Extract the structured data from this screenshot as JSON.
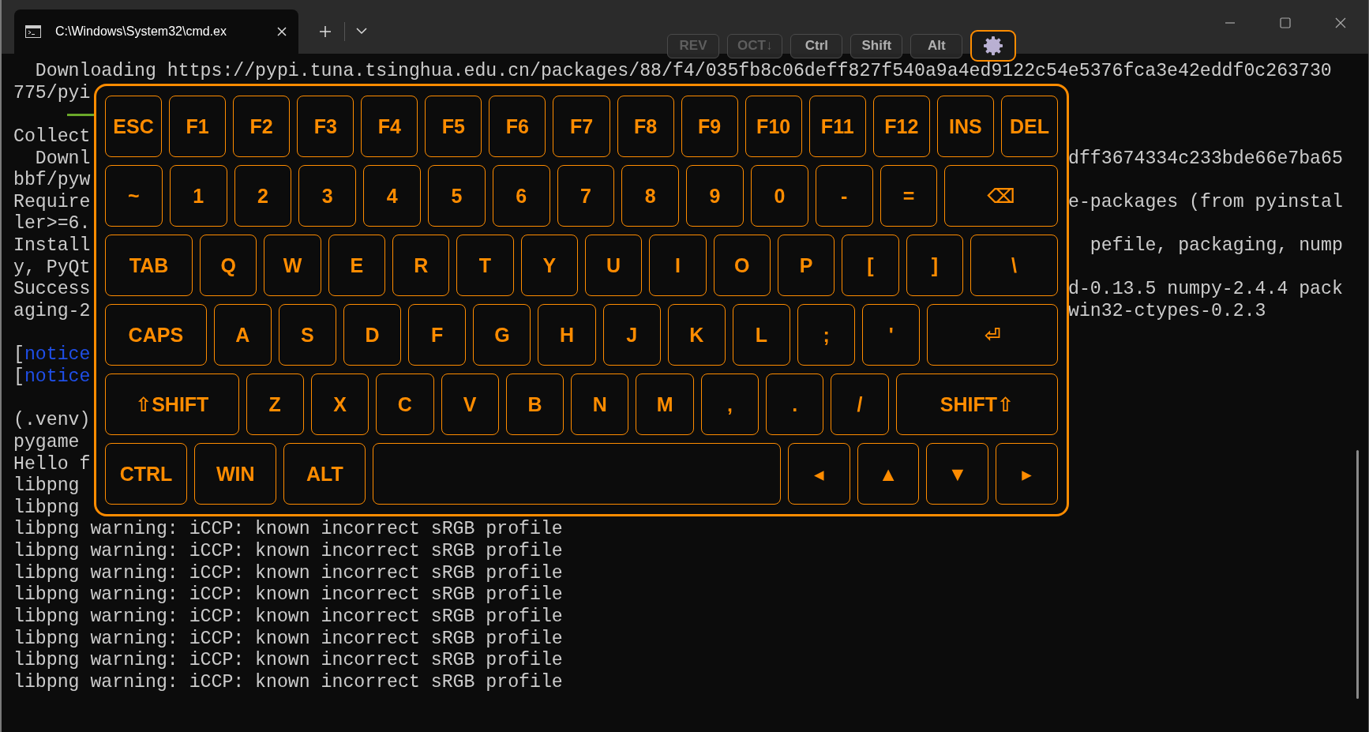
{
  "window": {
    "tab_title": "C:\\Windows\\System32\\cmd.ex"
  },
  "toolbar": {
    "items": [
      {
        "kind": "text",
        "label": "REV",
        "disabled": true,
        "active": false
      },
      {
        "kind": "text",
        "label": "OCT↓",
        "disabled": true,
        "active": false
      },
      {
        "kind": "text",
        "label": "Ctrl",
        "disabled": false,
        "active": false
      },
      {
        "kind": "text",
        "label": "Shift",
        "disabled": false,
        "active": false
      },
      {
        "kind": "text",
        "label": "Alt",
        "disabled": false,
        "active": false
      },
      {
        "kind": "settings",
        "disabled": false,
        "active": true
      }
    ]
  },
  "terminal": {
    "lines": [
      {
        "kind": "text",
        "text": "  Downloading https://pypi.tuna.tsinghua.edu.cn/packages/88/f4/035fb8c06deff827f540a9a4ed9122c54e5376fca3e42eddf0c263730"
      },
      {
        "kind": "text",
        "text": "775/pyi"
      },
      {
        "kind": "progress",
        "level": 1
      },
      {
        "kind": "text",
        "text": "Collect"
      },
      {
        "kind": "text",
        "text": "  Downl",
        "right": "dff3674334c233bde66e7ba65"
      },
      {
        "kind": "text",
        "text": "bbf/pyw"
      },
      {
        "kind": "text",
        "text": "Require",
        "right": "e-packages (from pyinstal"
      },
      {
        "kind": "text",
        "text": "ler>=6."
      },
      {
        "kind": "text",
        "text": "Install",
        "right": "  pefile, packaging, nump"
      },
      {
        "kind": "text",
        "text": "y, PyQt"
      },
      {
        "kind": "text",
        "text": "Success",
        "right": "d-0.13.5 numpy-2.4.4 pack"
      },
      {
        "kind": "text",
        "text": "aging-2",
        "right": "win32-ctypes-0.2.3"
      },
      {
        "kind": "blank"
      },
      {
        "kind": "text",
        "segments": [
          {
            "kind": "plain",
            "text": "["
          },
          {
            "kind": "notice",
            "text": "notice"
          }
        ]
      },
      {
        "kind": "text",
        "segments": [
          {
            "kind": "plain",
            "text": "["
          },
          {
            "kind": "notice",
            "text": "notice"
          }
        ]
      },
      {
        "kind": "blank"
      },
      {
        "kind": "text",
        "text": "(.venv)"
      },
      {
        "kind": "text",
        "text": "pygame"
      },
      {
        "kind": "text",
        "text": "Hello f"
      },
      {
        "kind": "text",
        "text": "libpng"
      },
      {
        "kind": "text",
        "text": "libpng"
      },
      {
        "kind": "text",
        "text": "libpng warning: iCCP: known incorrect sRGB profile"
      },
      {
        "kind": "text",
        "text": "libpng warning: iCCP: known incorrect sRGB profile"
      },
      {
        "kind": "text",
        "text": "libpng warning: iCCP: known incorrect sRGB profile"
      },
      {
        "kind": "text",
        "text": "libpng warning: iCCP: known incorrect sRGB profile"
      },
      {
        "kind": "text",
        "text": "libpng warning: iCCP: known incorrect sRGB profile"
      },
      {
        "kind": "text",
        "text": "libpng warning: iCCP: known incorrect sRGB profile"
      },
      {
        "kind": "text",
        "text": "libpng warning: iCCP: known incorrect sRGB profile"
      },
      {
        "kind": "text",
        "text": "libpng warning: iCCP: known incorrect sRGB profile"
      }
    ]
  },
  "keyboard": {
    "rows": [
      {
        "keys": [
          {
            "kind": "key",
            "label": "ESC"
          },
          {
            "kind": "key",
            "label": "F1"
          },
          {
            "kind": "key",
            "label": "F2"
          },
          {
            "kind": "key",
            "label": "F3"
          },
          {
            "kind": "key",
            "label": "F4"
          },
          {
            "kind": "key",
            "label": "F5"
          },
          {
            "kind": "key",
            "label": "F6"
          },
          {
            "kind": "key",
            "label": "F7"
          },
          {
            "kind": "key",
            "label": "F8"
          },
          {
            "kind": "key",
            "label": "F9"
          },
          {
            "kind": "key",
            "label": "F10"
          },
          {
            "kind": "key",
            "label": "F11"
          },
          {
            "kind": "key",
            "label": "F12"
          },
          {
            "kind": "key",
            "label": "INS"
          },
          {
            "kind": "key",
            "label": "DEL"
          }
        ]
      },
      {
        "keys": [
          {
            "kind": "key",
            "label": "~"
          },
          {
            "kind": "key",
            "label": "1"
          },
          {
            "kind": "key",
            "label": "2"
          },
          {
            "kind": "key",
            "label": "3"
          },
          {
            "kind": "key",
            "label": "4"
          },
          {
            "kind": "key",
            "label": "5"
          },
          {
            "kind": "key",
            "label": "6"
          },
          {
            "kind": "key",
            "label": "7"
          },
          {
            "kind": "key",
            "label": "8"
          },
          {
            "kind": "key",
            "label": "9"
          },
          {
            "kind": "key",
            "label": "0"
          },
          {
            "kind": "key",
            "label": "-"
          },
          {
            "kind": "key",
            "label": "="
          },
          {
            "kind": "wide",
            "label": "⌫"
          }
        ]
      },
      {
        "keys": [
          {
            "kind": "wide",
            "label": "TAB"
          },
          {
            "kind": "key",
            "label": "Q"
          },
          {
            "kind": "key",
            "label": "W"
          },
          {
            "kind": "key",
            "label": "E"
          },
          {
            "kind": "key",
            "label": "R"
          },
          {
            "kind": "key",
            "label": "T"
          },
          {
            "kind": "key",
            "label": "Y"
          },
          {
            "kind": "key",
            "label": "U"
          },
          {
            "kind": "key",
            "label": "I"
          },
          {
            "kind": "key",
            "label": "O"
          },
          {
            "kind": "key",
            "label": "P"
          },
          {
            "kind": "key",
            "label": "["
          },
          {
            "kind": "key",
            "label": "]"
          },
          {
            "kind": "wide",
            "label": "\\"
          }
        ]
      },
      {
        "keys": [
          {
            "kind": "wide",
            "label": "CAPS"
          },
          {
            "kind": "key",
            "label": "A"
          },
          {
            "kind": "key",
            "label": "S"
          },
          {
            "kind": "key",
            "label": "D"
          },
          {
            "kind": "key",
            "label": "F"
          },
          {
            "kind": "key",
            "label": "G"
          },
          {
            "kind": "key",
            "label": "H"
          },
          {
            "kind": "key",
            "label": "J"
          },
          {
            "kind": "key",
            "label": "K"
          },
          {
            "kind": "key",
            "label": "L"
          },
          {
            "kind": "key",
            "label": ";"
          },
          {
            "kind": "key",
            "label": "'"
          },
          {
            "kind": "wide",
            "label": "⏎"
          }
        ]
      },
      {
        "keys": [
          {
            "kind": "wide",
            "label": "⇧SHIFT"
          },
          {
            "kind": "key",
            "label": "Z"
          },
          {
            "kind": "key",
            "label": "X"
          },
          {
            "kind": "key",
            "label": "C"
          },
          {
            "kind": "key",
            "label": "V"
          },
          {
            "kind": "key",
            "label": "B"
          },
          {
            "kind": "key",
            "label": "N"
          },
          {
            "kind": "key",
            "label": "M"
          },
          {
            "kind": "key",
            "label": ","
          },
          {
            "kind": "key",
            "label": "."
          },
          {
            "kind": "key",
            "label": "/"
          },
          {
            "kind": "wide",
            "label": "SHIFT⇧"
          }
        ]
      },
      {
        "keys": [
          {
            "kind": "mod",
            "label": "CTRL"
          },
          {
            "kind": "mod",
            "label": "WIN"
          },
          {
            "kind": "mod",
            "label": "ALT"
          },
          {
            "kind": "space"
          },
          {
            "kind": "key",
            "label": "◂"
          },
          {
            "kind": "key",
            "label": "▲"
          },
          {
            "kind": "key",
            "label": "▼"
          },
          {
            "kind": "key",
            "label": "▸"
          }
        ]
      }
    ]
  }
}
